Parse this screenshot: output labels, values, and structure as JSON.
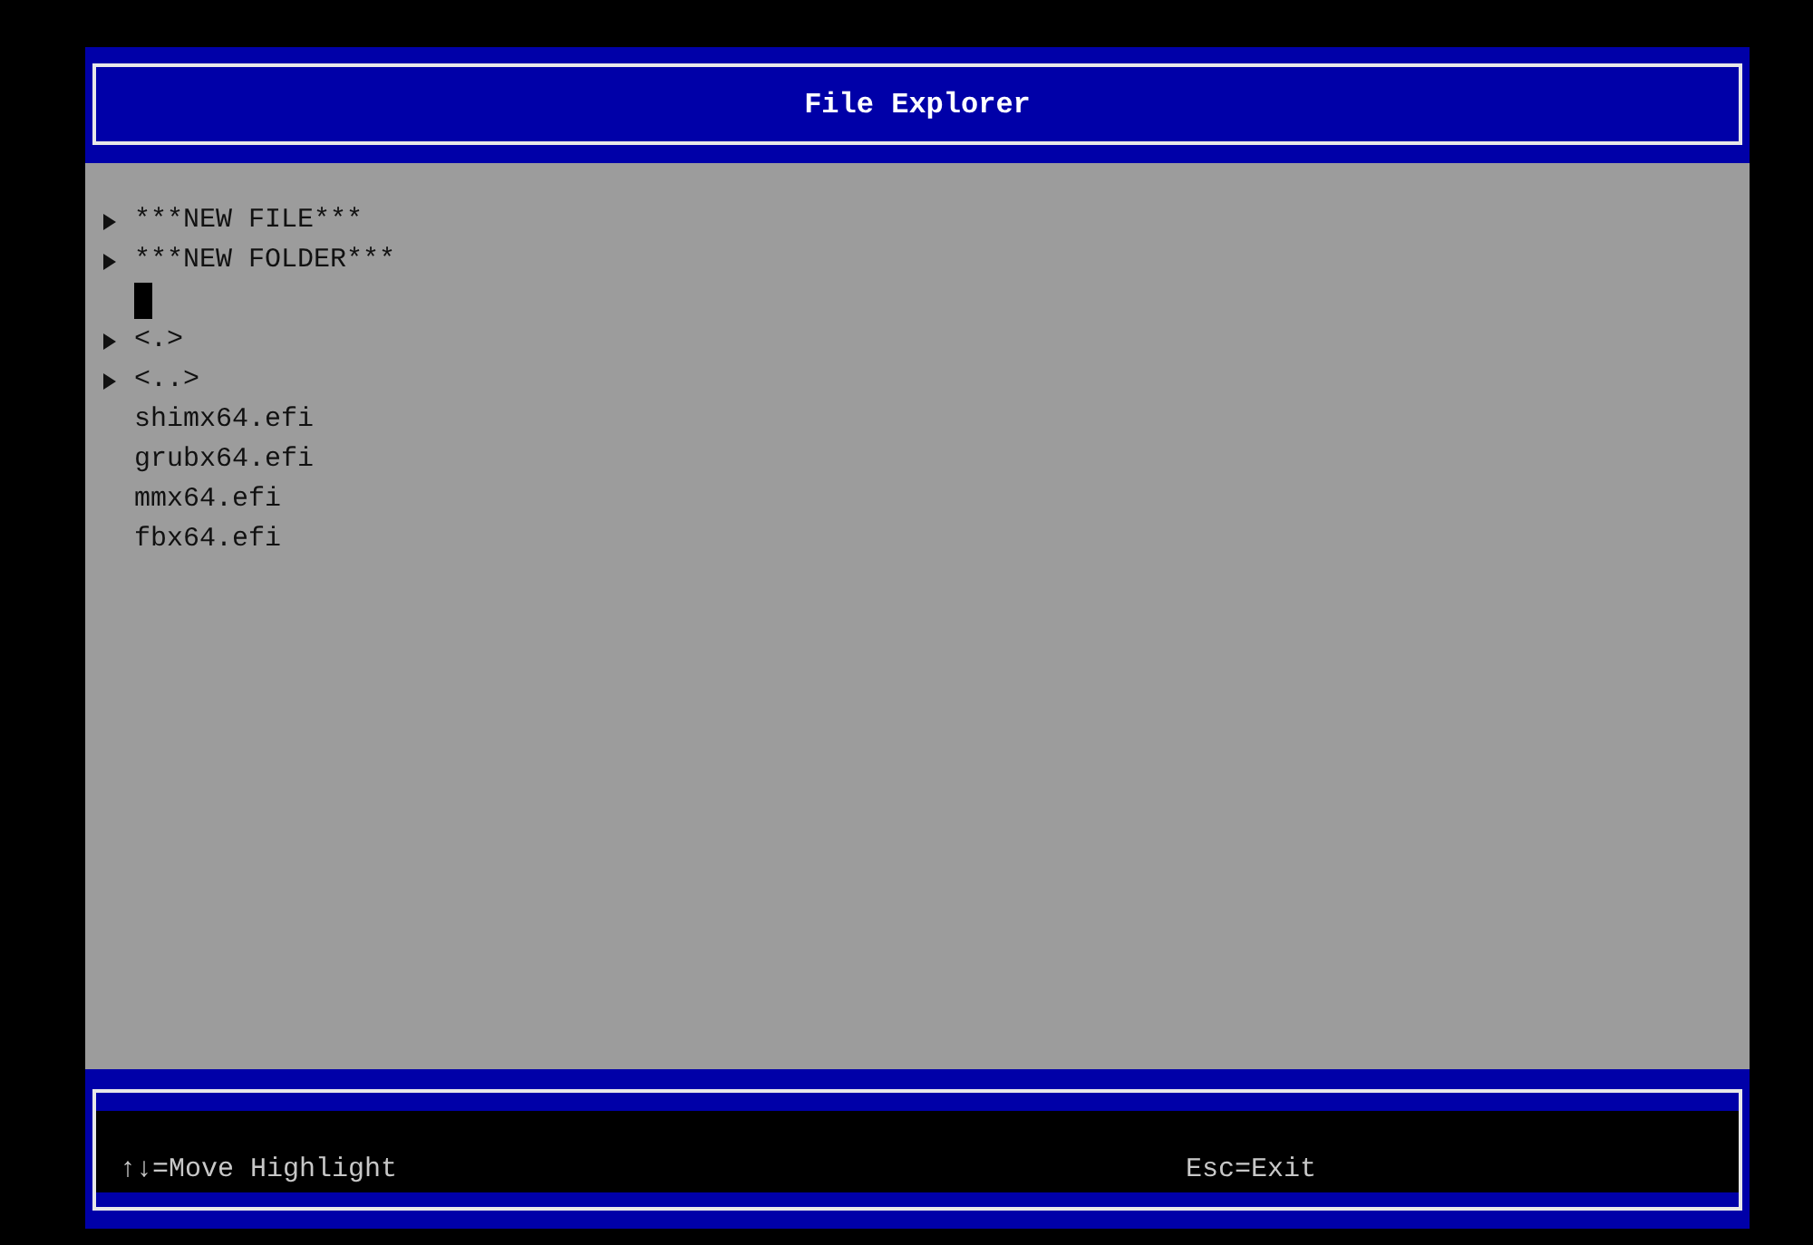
{
  "window": {
    "title": "File Explorer"
  },
  "items": [
    {
      "kind": "menu",
      "text": "***NEW FILE***"
    },
    {
      "kind": "menu",
      "text": "***NEW FOLDER***"
    },
    {
      "kind": "cursor"
    },
    {
      "kind": "menu",
      "text": "<.>"
    },
    {
      "kind": "menu",
      "text": "<..>"
    },
    {
      "kind": "file",
      "text": "shimx64.efi"
    },
    {
      "kind": "file",
      "text": "grubx64.efi"
    },
    {
      "kind": "file",
      "text": "mmx64.efi"
    },
    {
      "kind": "file",
      "text": "fbx64.efi"
    }
  ],
  "status_bar": {
    "hints": [
      {
        "text": "↑↓=Move Highlight"
      },
      {
        "text": "Esc=Exit"
      }
    ]
  }
}
